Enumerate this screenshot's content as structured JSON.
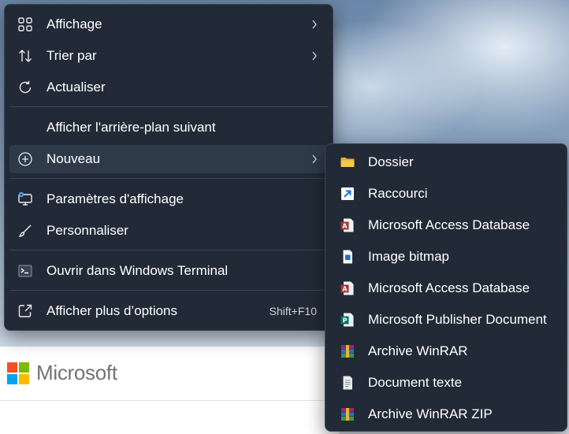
{
  "main_menu": {
    "items": [
      {
        "label": "Affichage",
        "icon": "grid-view-icon",
        "submenu": true
      },
      {
        "label": "Trier par",
        "icon": "sort-arrows-icon",
        "submenu": true
      },
      {
        "label": "Actualiser",
        "icon": "refresh-icon",
        "submenu": false
      },
      {
        "label": "Afficher l'arrière-plan suivant",
        "icon": "",
        "submenu": false
      },
      {
        "label": "Nouveau",
        "icon": "plus-circle-icon",
        "submenu": true,
        "highlighted": true
      },
      {
        "label": "Paramètres d'affichage",
        "icon": "display-settings-icon",
        "submenu": false
      },
      {
        "label": "Personnaliser",
        "icon": "brush-icon",
        "submenu": false
      },
      {
        "label": "Ouvrir dans Windows Terminal",
        "icon": "terminal-icon",
        "submenu": false
      },
      {
        "label": "Afficher plus d’options",
        "icon": "more-options-icon",
        "submenu": false,
        "shortcut": "Shift+F10"
      }
    ]
  },
  "new_submenu": {
    "items": [
      {
        "label": "Dossier",
        "icon": "folder-icon"
      },
      {
        "label": "Raccourci",
        "icon": "shortcut-icon"
      },
      {
        "label": "Microsoft Access Database",
        "icon": "access-database-icon"
      },
      {
        "label": "Image bitmap",
        "icon": "bitmap-image-icon"
      },
      {
        "label": "Microsoft Access Database",
        "icon": "access-database-icon"
      },
      {
        "label": "Microsoft Publisher Document",
        "icon": "publisher-document-icon"
      },
      {
        "label": "Archive WinRAR",
        "icon": "winrar-archive-icon"
      },
      {
        "label": "Document texte",
        "icon": "text-document-icon"
      },
      {
        "label": "Archive WinRAR ZIP",
        "icon": "winrar-zip-icon"
      }
    ]
  },
  "background": {
    "logo_text": "Microsoft"
  },
  "colors": {
    "menu_bg": "#212a36",
    "menu_hover": "#2f3a49",
    "accent_blue": "#4fa3e8",
    "ms_red": "#f25022",
    "ms_green": "#7fba00",
    "ms_blue": "#00a4ef",
    "ms_yellow": "#ffb900"
  }
}
